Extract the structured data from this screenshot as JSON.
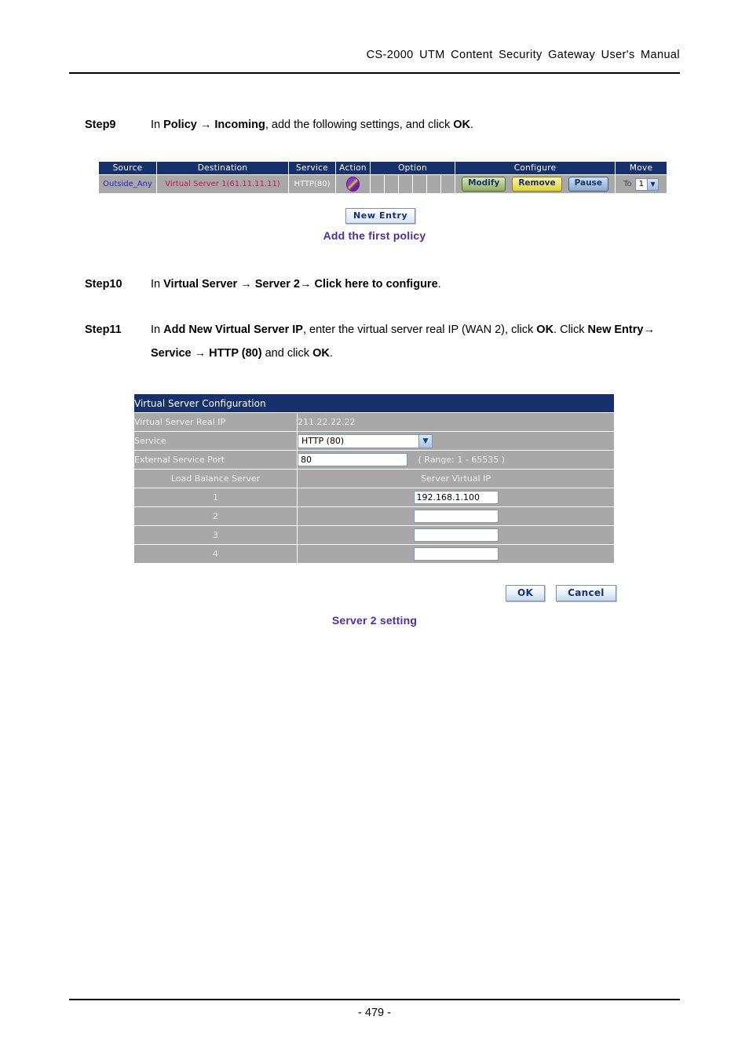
{
  "document": {
    "header_title": "CS-2000 UTM Content Security Gateway User's Manual",
    "page_number": "- 479 -"
  },
  "steps": [
    {
      "label": "Step9",
      "parts": [
        {
          "t": "In ",
          "b": false
        },
        {
          "t": "Policy",
          "b": true
        },
        {
          "t": " → ",
          "b": true
        },
        {
          "t": "Incoming",
          "b": true
        },
        {
          "t": ", add the following settings, and click ",
          "b": false
        },
        {
          "t": "OK",
          "b": true
        },
        {
          "t": ".",
          "b": false
        }
      ]
    },
    {
      "label": "Step10",
      "parts": [
        {
          "t": "In ",
          "b": false
        },
        {
          "t": "Virtual Server",
          "b": true
        },
        {
          "t": " → ",
          "b": true
        },
        {
          "t": "Server 2→ ",
          "b": true
        },
        {
          "t": "Click here to configure",
          "b": true
        },
        {
          "t": ".",
          "b": false
        }
      ]
    },
    {
      "label": "Step11",
      "parts": [
        {
          "t": "In ",
          "b": false
        },
        {
          "t": "Add New Virtual Server IP",
          "b": true
        },
        {
          "t": ", enter the virtual server real IP (WAN 2), click ",
          "b": false
        },
        {
          "t": "OK",
          "b": true
        },
        {
          "t": ". Click ",
          "b": false
        },
        {
          "t": "New Entry→ Service → HTTP (80)",
          "b": true
        },
        {
          "t": " and click ",
          "b": false
        },
        {
          "t": "OK",
          "b": true
        },
        {
          "t": ".",
          "b": false
        }
      ]
    }
  ],
  "policy_table": {
    "headers": [
      "Source",
      "Destination",
      "Service",
      "Action",
      "Option",
      "Configure",
      "Move"
    ],
    "row": {
      "source": "Outside_Any",
      "destination": "Virtual Server 1(61.11.11.11)",
      "service": "HTTP(80)",
      "action_icon": "policy-permit-icon",
      "option_cells": [
        "",
        "",
        "",
        "",
        "",
        ""
      ],
      "configure": [
        "Modify",
        "Remove",
        "Pause"
      ],
      "move_prefix": "To",
      "move_value": "1"
    },
    "new_entry_label": "New  Entry",
    "caption": "Add the first policy",
    "colors": {
      "header_bg": "#16306b",
      "row_bg": "#a8a8a8",
      "source_text": "#2222cc",
      "destination_text": "#cc1155",
      "caption": "#4b2ea8"
    }
  },
  "virtual_server": {
    "title": "Virtual Server Configuration",
    "rows": {
      "real_ip_label": "Virtual Server Real IP",
      "real_ip_value": "211.22.22.22",
      "service_label": "Service",
      "service_value": "HTTP (80)",
      "port_label": "External Service Port",
      "port_value": "80",
      "port_range": "( Range: 1 - 65535 )",
      "lb_label": "Load Balance Server",
      "lb_value_header": "Server Virtual IP"
    },
    "servers": [
      {
        "index": "1",
        "ip": "192.168.1.100"
      },
      {
        "index": "2",
        "ip": ""
      },
      {
        "index": "3",
        "ip": ""
      },
      {
        "index": "4",
        "ip": ""
      }
    ],
    "buttons": {
      "ok": "OK",
      "cancel": "Cancel"
    },
    "caption": "Server 2 setting",
    "colors": {
      "title_bg": "#16306b",
      "row_bg": "#a8a8a8",
      "caption": "#4b2ea8"
    }
  }
}
